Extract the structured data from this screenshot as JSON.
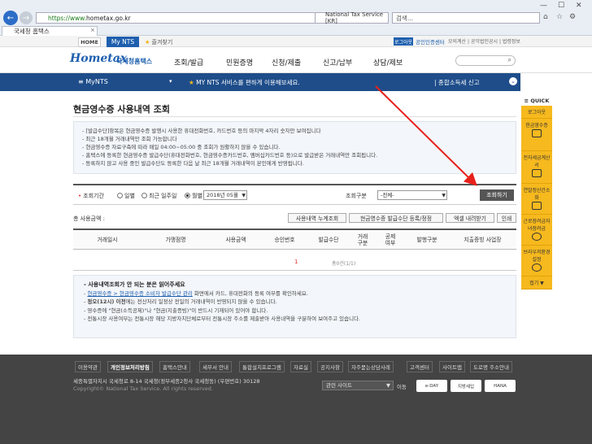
{
  "browser": {
    "url_prefix": "https://www.",
    "url_domain": "hometax.go.kr",
    "cert_label": "National Tax Service [KR]",
    "search_placeholder": "검색...",
    "tab_title": "국세청 홈택스"
  },
  "util": {
    "home": "HOME",
    "mynts": "My NTS",
    "favorite": "즐겨찾기",
    "login": "로그아웃",
    "cert_center": "공인인증센터",
    "links": "모의계산 | 공익법인공시 | 법령정보"
  },
  "header": {
    "logo": "Hometax",
    "logo_sub": "국세청홈택스",
    "menu": [
      "조회/발급",
      "민원증명",
      "신청/제출",
      "신고/납부",
      "상담/제보"
    ]
  },
  "bluebar": {
    "title": "≡  MyNTS",
    "message": "MY NTS 서비스를 편하게 이용해보세요.",
    "right": "종합소득세 신고"
  },
  "quick": {
    "header": "≡ QUICK",
    "items": [
      "로그아웃",
      "현금영수증",
      "전자세금계산서",
      "연말정산간소화",
      "근로장려금자녀장려금",
      "브라우저환경설정",
      "접기 ▼"
    ]
  },
  "page": {
    "title": "현금영수증 사용내역 조회",
    "info": [
      "- [발급수단]항목은 현금영수증 발행시 사용한 휴대전화번호, 카드번호 등의 마지막 4자리 숫자만 보여집니다",
      "- 최근 18개월 거래내역만 조회 가능합니다",
      "- 현금영수증 자료구축에 따라 매일 04:00~05:00 중 조회가 원활하지 않을 수 있습니다.",
      "- 홈택스에 등록한 현금영수증 발급수단(휴대전화번호, 현금영수증카드번호, 멤버십카드번호 등)으로 발급받은 거래내역만 조회됩니다.",
      "  - 등록하지 않고 사용 중인 발급수단도 등록한 다음 날 최근 18개월 거래내역이 본인에게 반영됩니다."
    ],
    "search": {
      "period_label": "조회기간",
      "radios": [
        "일별",
        "최근 일주일",
        "월별"
      ],
      "month_value": "2018년 05월",
      "type_label": "조회구분",
      "type_value": "-전체-",
      "query_button": "조회하기"
    },
    "total_label": "총 사용금액 :",
    "actions": [
      "사용내역 누계조회",
      "현금영수증 발급수단 등록/정정",
      "엑셀 내려받기",
      "인쇄"
    ],
    "columns": [
      "거래일시",
      "가맹점명",
      "사용금액",
      "승인번호",
      "발급수단",
      "거래\n구분",
      "공제\n여부",
      "발행구분",
      "지출증빙 사업장"
    ],
    "pager": "1",
    "count": "총0건(1/1)",
    "notice": {
      "title": "- 사용내역조회가 안 되는 분은 읽어주세요",
      "link": "현금영수증 > 현금영수증 소비자 발급수단 관리",
      "line1_rest": " 화면에서 카드, 휴대전화의 등록 여부를 확인하세요.",
      "line2_bold": "정오(12시) 이전",
      "line2_rest": "에는 전산처리 일정상 전일의 거래내역이 반영되지 않을 수 있습니다.",
      "line3": "- 영수증에 \"현금(소득공제)\"나 \"현금(지출증빙)\"이 반드시 기재되어 있어야 합니다.",
      "line4": "- 전통시장 사용여부는 전통시장 해당 지방자치단체로부터 전통시장 주소를 제출받아 사용내역을 구분하여 보여주고 있습니다."
    }
  },
  "footer": {
    "links": [
      "이용약관",
      "개인정보처리방침",
      "홈택스안내",
      "세무서 안내",
      "통합설치프로그램",
      "자료실",
      "공지사항",
      "자주묻는상담사례",
      "고객센터",
      "사이트맵",
      "도로명 주소안내"
    ],
    "address": "세종특별자치시 국세청로 8-14 국세청(정부세종2청사 국세청동) (우편번호) 30128",
    "copyright": "Copyright© National Tax Service. All rights reserved.",
    "related": "관련 사이트",
    "go": "이동",
    "badges": [
      "e-DAY",
      "지방세입",
      "HANA"
    ]
  }
}
